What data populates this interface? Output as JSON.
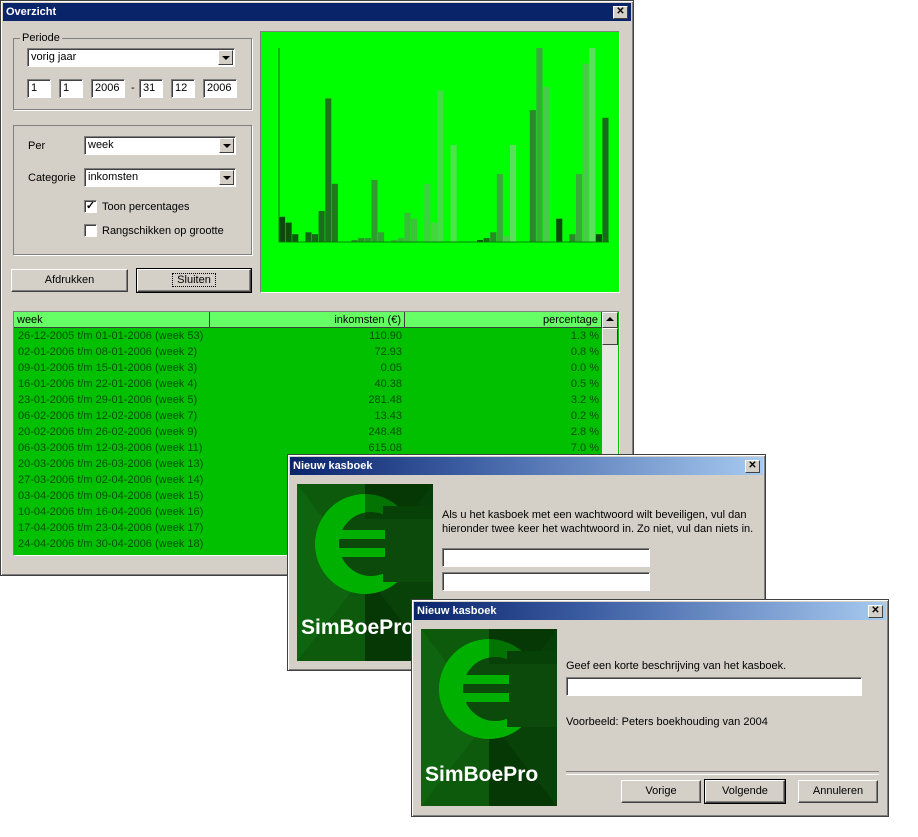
{
  "overzicht": {
    "title": "Overzicht",
    "periode_label": "Periode",
    "periode_value": "vorig jaar",
    "date_from": {
      "day": "1",
      "month": "1",
      "year": "2006"
    },
    "date_sep": "-",
    "date_to": {
      "day": "31",
      "month": "12",
      "year": "2006"
    },
    "per_label": "Per",
    "per_value": "week",
    "categorie_label": "Categorie",
    "categorie_value": "inkomsten",
    "toon_percentages_label": "Toon percentages",
    "toon_percentages_checked": true,
    "rangschikken_label": "Rangschikken op grootte",
    "rangschikken_checked": false,
    "afdrukken_label": "Afdrukken",
    "sluiten_label": "Sluiten",
    "chart_background": "#00ff00",
    "table": {
      "headers": [
        "week",
        "inkomsten (€)",
        "percentage"
      ],
      "rows": [
        [
          "26-12-2005 t/m 01-01-2006 (week 53)",
          "110.90",
          "1.3 %"
        ],
        [
          "02-01-2006 t/m 08-01-2006 (week 2)",
          "72.93",
          "0.8 %"
        ],
        [
          "09-01-2006 t/m 15-01-2006 (week 3)",
          "0.05",
          "0.0 %"
        ],
        [
          "16-01-2006 t/m 22-01-2006 (week 4)",
          "40.38",
          "0.5 %"
        ],
        [
          "23-01-2006 t/m 29-01-2006 (week 5)",
          "281.48",
          "3.2 %"
        ],
        [
          "06-02-2006 t/m 12-02-2006 (week 7)",
          "13.43",
          "0.2 %"
        ],
        [
          "20-02-2006 t/m 26-02-2006 (week 9)",
          "248.48",
          "2.8 %"
        ],
        [
          "06-03-2006 t/m 12-03-2006 (week 11)",
          "615.08",
          "7.0 %"
        ],
        [
          "20-03-2006 t/m 26-03-2006 (week 13)",
          "",
          ""
        ],
        [
          "27-03-2006 t/m 02-04-2006 (week 14)",
          "",
          ""
        ],
        [
          "03-04-2006 t/m 09-04-2006 (week 15)",
          "",
          ""
        ],
        [
          "10-04-2006 t/m 16-04-2006 (week 16)",
          "",
          ""
        ],
        [
          "17-04-2006 t/m 23-04-2006 (week 17)",
          "",
          ""
        ],
        [
          "24-04-2006 t/m 30-04-2006 (week 18)",
          "",
          ""
        ]
      ]
    }
  },
  "chart_data": {
    "type": "bar",
    "values": [
      0.13,
      0.1,
      0.04,
      0.0,
      0.05,
      0.04,
      0.16,
      0.74,
      0.3,
      0.0,
      0.0,
      0.01,
      0.02,
      0.02,
      0.32,
      0.05,
      0.0,
      0.01,
      0.02,
      0.15,
      0.12,
      0.0,
      0.3,
      0.1,
      0.78,
      0.0,
      0.5,
      0.0,
      0.0,
      0.0,
      0.01,
      0.02,
      0.05,
      0.35,
      0.03,
      0.5,
      0.0,
      0.0,
      0.68,
      1.0,
      0.8,
      0.0,
      0.12,
      0.0,
      0.04,
      0.35,
      0.92,
      1.0,
      0.04,
      0.64
    ],
    "colors": [
      "#0a4a0a",
      "#0d500d",
      "#0f560f",
      "#125c12",
      "#146214",
      "#176817",
      "#196e19",
      "#1c741c",
      "#1e7a1e",
      "#218021",
      "#238623",
      "#268c26",
      "#289228",
      "#2b982b",
      "#2d9e2d",
      "#30a430",
      "#32aa32",
      "#35b035",
      "#37b637",
      "#3abc3a",
      "#3cc23c",
      "#3fc83f",
      "#41ce41",
      "#44d444",
      "#46da46",
      "#49e049",
      "#4be64b",
      "#4eec4e",
      "#50f250",
      "#53f853",
      "#0a4a0a",
      "#1a6a1a",
      "#2a8a2a",
      "#3aaa3a",
      "#4aca4a",
      "#5ae05a",
      "#0a4a0a",
      "#1a6a1a",
      "#2a8a2a",
      "#3aaa3a",
      "#4aca4a",
      "#5ae05a",
      "#0a4a0a",
      "#1a6a1a",
      "#2a8a2a",
      "#3aaa3a",
      "#4aca4a",
      "#5ae05a",
      "#0a4a0a",
      "#1a6a1a"
    ]
  },
  "kasboek1": {
    "title": "Nieuw kasboek",
    "logo_text": "SimBoePro",
    "message": "Als u het kasboek met een wachtwoord wilt beveiligen, vul dan hieronder twee keer het wachtwoord in. Zo niet, vul dan niets in."
  },
  "kasboek2": {
    "title": "Nieuw kasboek",
    "logo_text": "SimBoePro",
    "message": "Geef een korte beschrijving van het kasboek.",
    "description_value": "",
    "example": "Voorbeeld: Peters boekhouding van 2004",
    "vorige_label": "Vorige",
    "volgende_label": "Volgende",
    "annuleren_label": "Annuleren"
  }
}
